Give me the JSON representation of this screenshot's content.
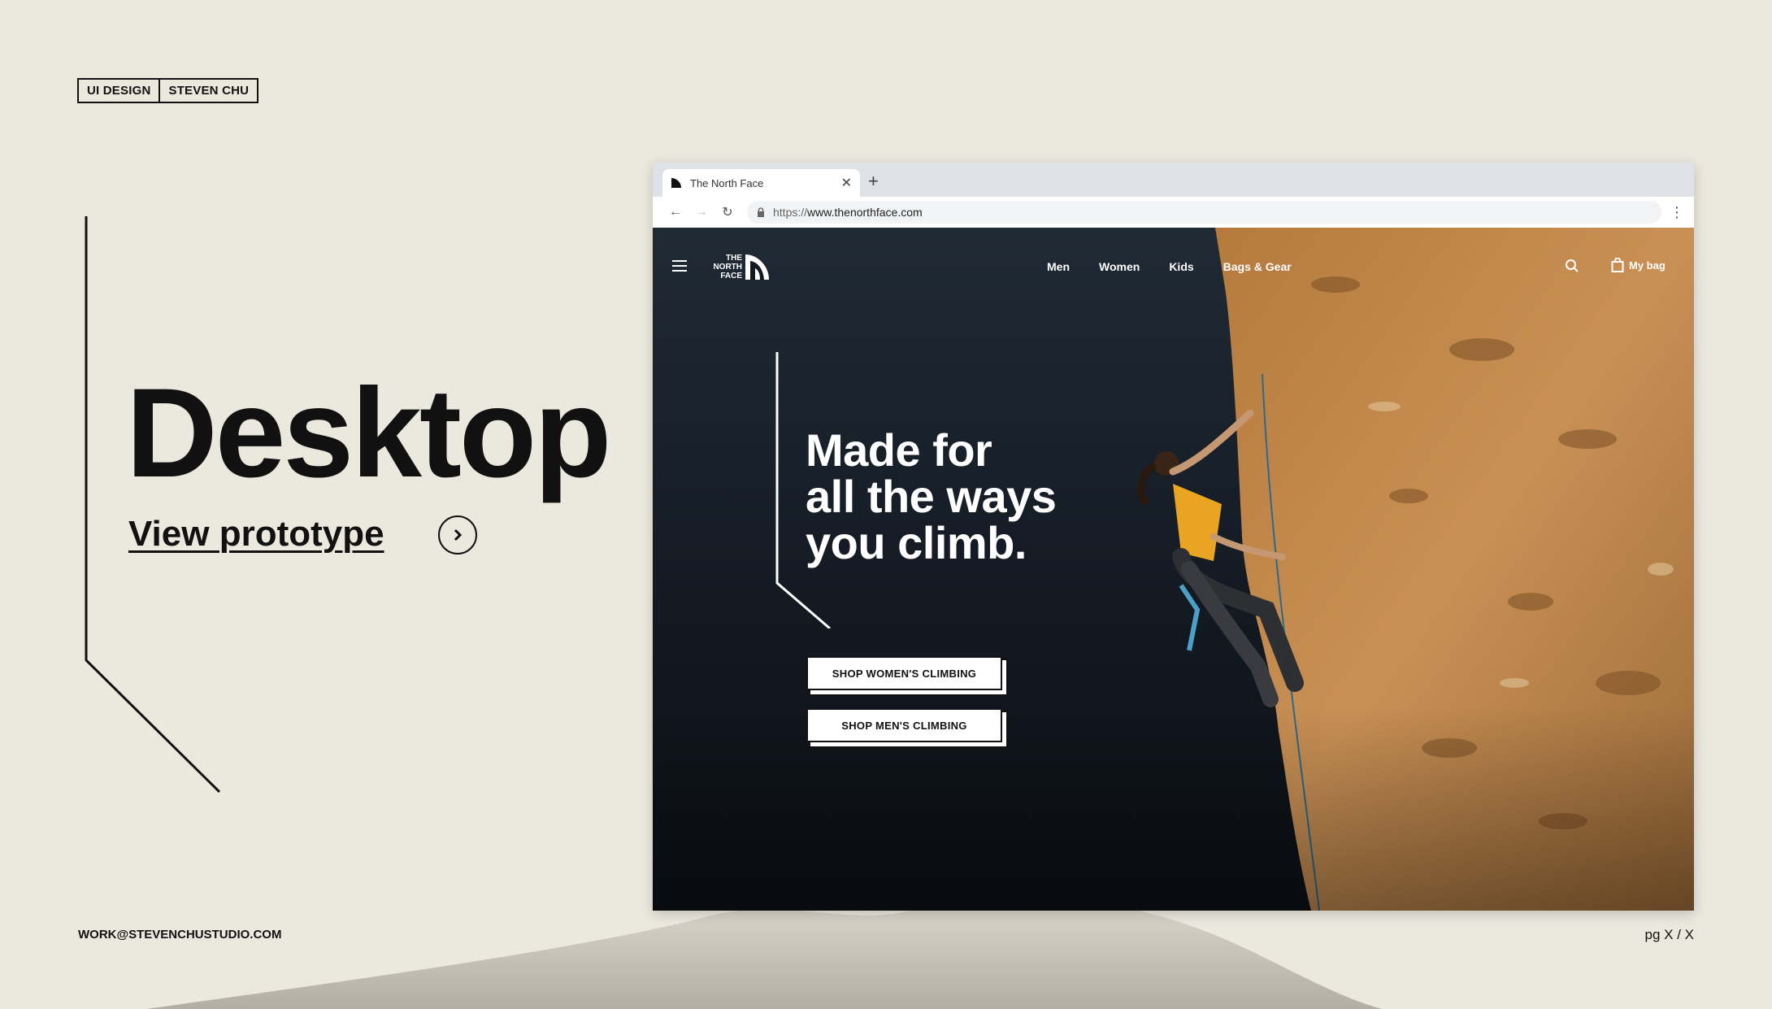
{
  "tags": [
    "UI DESIGN",
    "STEVEN CHU"
  ],
  "title": "Desktop",
  "prototype_link": "View prototype",
  "footer": {
    "email": "WORK@STEVENCHUSTUDIO.COM",
    "page": "pg X / X"
  },
  "browser": {
    "tab_title": "The North Face",
    "url_scheme": "https://",
    "url_host": "www.thenorthface.com"
  },
  "site": {
    "nav": [
      "Men",
      "Women",
      "Kids",
      "Bags & Gear"
    ],
    "bag_label": "My bag",
    "hero_title_lines": [
      "Made for",
      "all the ways",
      "you climb."
    ],
    "cta": [
      "SHOP WOMEN'S CLIMBING",
      "SHOP MEN'S CLIMBING"
    ]
  },
  "colors": {
    "page_bg": "#ebe8de",
    "ink": "#111111",
    "rock": "#c08448",
    "night": "#141a22"
  },
  "icons": [
    "chevron-right-icon",
    "close-icon",
    "plus-icon",
    "back-arrow-icon",
    "forward-arrow-icon",
    "reload-icon",
    "lock-icon",
    "kebab-menu-icon",
    "hamburger-icon",
    "search-icon",
    "bag-icon"
  ]
}
